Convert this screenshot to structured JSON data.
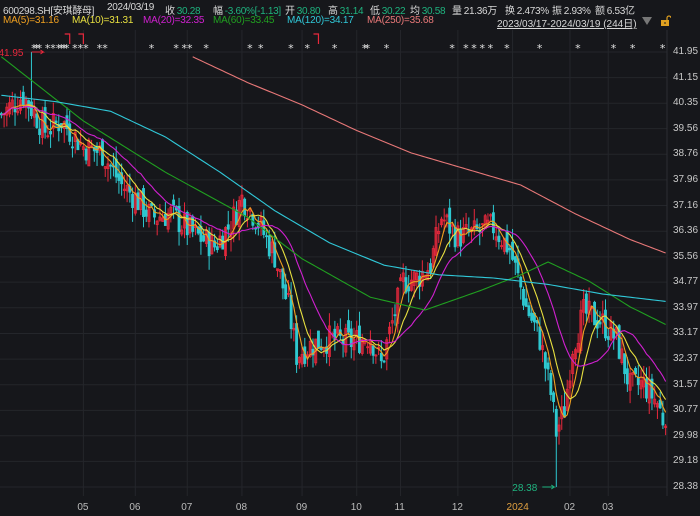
{
  "header": {
    "code": "600298.SH[安琪酵母]",
    "date": "2024/03/19",
    "close_label": "收",
    "close": "30.28",
    "chg_label": "幅",
    "chg": "-3.60%[-1.13]",
    "open_label": "开",
    "open": "30.80",
    "high_label": "高",
    "high": "31.14",
    "low_label": "低",
    "low": "30.22",
    "avg_label": "均",
    "avg": "30.58",
    "vol_label": "量",
    "vol": "21.36万",
    "turn_label": "换",
    "turn": "2.473%",
    "amp_label": "振",
    "amp": "2.93%",
    "amt_label": "额",
    "amt": "6.53亿"
  },
  "ma": [
    {
      "label": "MA(5)=31.16",
      "color": "#f0a020"
    },
    {
      "label": "MA(10)=31.31",
      "color": "#e8e040"
    },
    {
      "label": "MA(20)=32.35",
      "color": "#d020d0"
    },
    {
      "label": "MA(60)=33.45",
      "color": "#20a020"
    },
    {
      "label": "MA(120)=34.17",
      "color": "#30c8d8"
    },
    {
      "label": "MA(250)=35.68",
      "color": "#e87878"
    }
  ],
  "range": "2023/03/17-2024/03/19 (244日)",
  "colors": {
    "up": "#e8283c",
    "down": "#2ec8d0",
    "marker": "#e0e0e0",
    "max": "#e8283c",
    "min": "#1fb37f"
  },
  "chart_data": {
    "type": "candlestick",
    "days": 244,
    "ylim": [
      28.38,
      41.95
    ],
    "yticks": [
      "41.95",
      "41.15",
      "40.35",
      "39.56",
      "38.76",
      "37.96",
      "37.16",
      "36.36",
      "35.56",
      "34.77",
      "33.97",
      "33.17",
      "32.37",
      "31.57",
      "30.77",
      "29.98",
      "29.18",
      "28.38"
    ],
    "xticks": [
      {
        "label": "05",
        "day": 30
      },
      {
        "label": "06",
        "day": 49
      },
      {
        "label": "07",
        "day": 68
      },
      {
        "label": "08",
        "day": 88
      },
      {
        "label": "09",
        "day": 110
      },
      {
        "label": "10",
        "day": 130
      },
      {
        "label": "11",
        "day": 146
      },
      {
        "label": "12",
        "day": 167
      },
      {
        "label": "2024",
        "day": 187,
        "highlight": true
      },
      {
        "label": "02",
        "day": 208
      },
      {
        "label": "03",
        "day": 222
      }
    ],
    "close_path": [
      [
        0,
        40.0
      ],
      [
        8,
        40.6
      ],
      [
        11,
        40.2
      ],
      [
        16,
        39.5
      ],
      [
        22,
        39.8
      ],
      [
        30,
        39.0
      ],
      [
        37,
        38.8
      ],
      [
        44,
        37.8
      ],
      [
        48,
        37.5
      ],
      [
        55,
        36.8
      ],
      [
        62,
        36.9
      ],
      [
        70,
        36.3
      ],
      [
        78,
        35.9
      ],
      [
        84,
        36.6
      ],
      [
        88,
        37.4
      ],
      [
        93,
        36.8
      ],
      [
        100,
        35.6
      ],
      [
        105,
        34.0
      ],
      [
        108,
        32.5
      ],
      [
        113,
        32.8
      ],
      [
        120,
        33.0
      ],
      [
        128,
        32.9
      ],
      [
        135,
        33.1
      ],
      [
        139,
        32.2
      ],
      [
        143,
        33.5
      ],
      [
        147,
        34.8
      ],
      [
        152,
        34.9
      ],
      [
        157,
        35.3
      ],
      [
        161,
        36.8
      ],
      [
        167,
        36.2
      ],
      [
        173,
        36.3
      ],
      [
        180,
        36.5
      ],
      [
        186,
        35.8
      ],
      [
        192,
        34.0
      ],
      [
        197,
        33.0
      ],
      [
        201,
        31.3
      ],
      [
        203,
        30.1
      ],
      [
        206,
        30.8
      ],
      [
        209,
        32.8
      ],
      [
        213,
        33.8
      ],
      [
        219,
        33.6
      ],
      [
        225,
        33.0
      ],
      [
        230,
        31.5
      ],
      [
        235,
        31.6
      ],
      [
        240,
        31.0
      ],
      [
        243,
        30.28
      ]
    ],
    "ma60_path": [
      [
        0,
        41.8
      ],
      [
        30,
        39.8
      ],
      [
        60,
        38.2
      ],
      [
        90,
        36.8
      ],
      [
        110,
        35.5
      ],
      [
        135,
        34.3
      ],
      [
        155,
        33.9
      ],
      [
        175,
        34.5
      ],
      [
        190,
        35.0
      ],
      [
        200,
        35.4
      ],
      [
        215,
        34.8
      ],
      [
        230,
        34.0
      ],
      [
        243,
        33.45
      ]
    ],
    "ma120_path": [
      [
        0,
        40.6
      ],
      [
        20,
        40.4
      ],
      [
        40,
        40.1
      ],
      [
        60,
        39.3
      ],
      [
        80,
        38.2
      ],
      [
        100,
        37.0
      ],
      [
        120,
        36.0
      ],
      [
        140,
        35.3
      ],
      [
        160,
        35.0
      ],
      [
        180,
        34.9
      ],
      [
        200,
        34.7
      ],
      [
        220,
        34.4
      ],
      [
        243,
        34.17
      ]
    ],
    "ma250_path": [
      [
        70,
        41.8
      ],
      [
        90,
        41.0
      ],
      [
        110,
        40.3
      ],
      [
        130,
        39.5
      ],
      [
        150,
        38.8
      ],
      [
        170,
        38.3
      ],
      [
        190,
        37.8
      ],
      [
        210,
        36.9
      ],
      [
        230,
        36.1
      ],
      [
        243,
        35.68
      ]
    ],
    "max_label": "41.95",
    "max_day": 11,
    "min_label": "28.38",
    "min_day": 203,
    "event_days": [
      12,
      13,
      14,
      17,
      19,
      21,
      22,
      23,
      24,
      27,
      29,
      31,
      36,
      38,
      55,
      64,
      67,
      69,
      75,
      91,
      95,
      106,
      112,
      122,
      133,
      134,
      141,
      165,
      170,
      173,
      176,
      179,
      185,
      197,
      211,
      224,
      231,
      242
    ],
    "flag_days": [
      25,
      30,
      116
    ]
  }
}
